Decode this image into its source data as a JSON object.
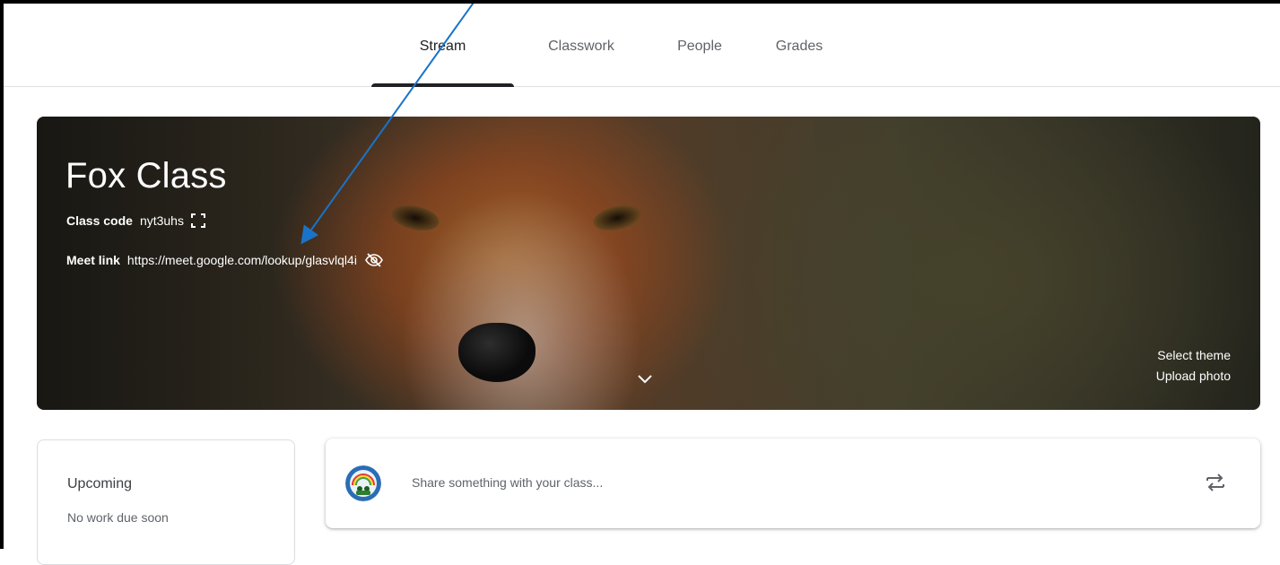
{
  "tabs": [
    {
      "label": "Stream",
      "active": true
    },
    {
      "label": "Classwork",
      "active": false
    },
    {
      "label": "People",
      "active": false
    },
    {
      "label": "Grades",
      "active": false
    }
  ],
  "banner": {
    "title": "Fox Class",
    "class_code_label": "Class code",
    "class_code_value": "nyt3uhs",
    "class_code_icon": "fullscreen-icon",
    "meet_link_label": "Meet link",
    "meet_link_value": "https://meet.google.com/lookup/glasvlql4i",
    "meet_link_icon": "visibility-off-icon",
    "select_theme": "Select theme",
    "upload_photo": "Upload photo",
    "expand_icon": "chevron-down-icon"
  },
  "upcoming": {
    "heading": "Upcoming",
    "status": "No work due soon"
  },
  "share": {
    "placeholder": "Share something with your class...",
    "repost_icon": "repost-icon"
  },
  "colors": {
    "annotation_arrow": "#1a73c8",
    "active_tab_indicator": "#202124",
    "card_border": "#dadce0"
  }
}
